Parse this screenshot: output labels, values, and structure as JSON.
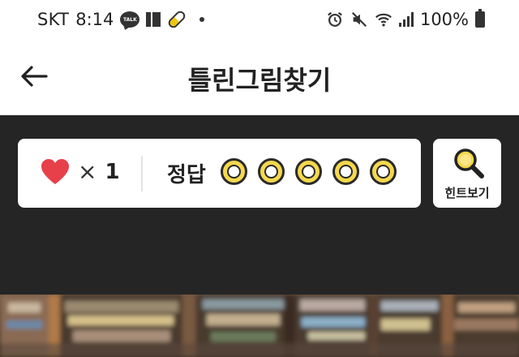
{
  "status_bar": {
    "carrier": "SKT",
    "time": "8:14",
    "talk_badge": "TALK",
    "battery": "100%",
    "icons": [
      "kakaotalk-icon",
      "news-icon",
      "pill-icon",
      "dot-icon",
      "alarm-icon",
      "mute-icon",
      "wifi-icon",
      "signal-icon",
      "battery-icon"
    ]
  },
  "header": {
    "title": "틀린그림찾기",
    "back_icon": "back-arrow-icon"
  },
  "game": {
    "lives_icon": "heart-icon",
    "lives_multiplier": "×",
    "lives_count": "1",
    "answer_label": "정답",
    "answers_found": 0,
    "answers_total": 5,
    "hint_label": "힌트보기",
    "hint_icon": "magnifier-icon"
  },
  "colors": {
    "panel_bg": "#252525",
    "heart": "#e8404a",
    "circle_fill": "#f5d84c"
  }
}
